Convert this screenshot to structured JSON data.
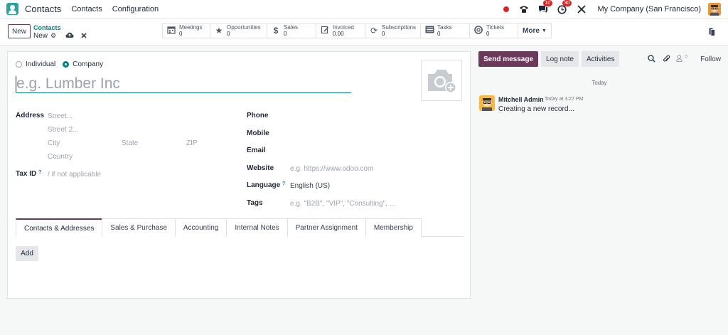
{
  "navbar": {
    "app_name": "Contacts",
    "menus": [
      "Contacts",
      "Configuration"
    ],
    "chat_count": "10",
    "activity_count": "30",
    "company": "My Company (San Francisco)"
  },
  "control": {
    "new_button": "New",
    "breadcrumb_parent": "Contacts",
    "breadcrumb_current": "New",
    "smart_buttons": [
      {
        "label": "Meetings",
        "value": "0",
        "icon": "calendar-icon"
      },
      {
        "label": "Opportunities",
        "value": "0",
        "icon": "star-icon"
      },
      {
        "label": "Sales",
        "value": "0",
        "icon": "dollar-icon"
      },
      {
        "label": "Invoiced",
        "value": "0.00",
        "icon": "invoice-icon"
      },
      {
        "label": "Subscriptions",
        "value": "0",
        "icon": "refresh-icon"
      },
      {
        "label": "Tasks",
        "value": "0",
        "icon": "tasks-icon"
      },
      {
        "label": "Tickets",
        "value": "0",
        "icon": "lifebuoy-icon"
      }
    ],
    "more_label": "More"
  },
  "form": {
    "type_individual": "Individual",
    "type_company": "Company",
    "name_placeholder": "e.g. Lumber Inc",
    "address_label": "Address",
    "street_ph": "Street...",
    "street2_ph": "Street 2...",
    "city_ph": "City",
    "state_ph": "State",
    "zip_ph": "ZIP",
    "country_ph": "Country",
    "taxid_label": "Tax ID",
    "taxid_ph": "/ if not applicable",
    "phone_label": "Phone",
    "mobile_label": "Mobile",
    "email_label": "Email",
    "website_label": "Website",
    "website_ph": "e.g. https://www.odoo.com",
    "language_label": "Language",
    "language_value": "English (US)",
    "tags_label": "Tags",
    "tags_ph": "e.g. \"B2B\", \"VIP\", \"Consulting\", ...",
    "help_mark": "?"
  },
  "tabs": [
    "Contacts & Addresses",
    "Sales & Purchase",
    "Accounting",
    "Internal Notes",
    "Partner Assignment",
    "Membership"
  ],
  "add_button": "Add",
  "chatter": {
    "send_message": "Send message",
    "log_note": "Log note",
    "activities": "Activities",
    "followers_count": "0",
    "follow": "Follow",
    "date_separator": "Today",
    "author": "Mitchell Admin",
    "time": "Today at 3:27 PM",
    "body": "Creating a new record..."
  }
}
